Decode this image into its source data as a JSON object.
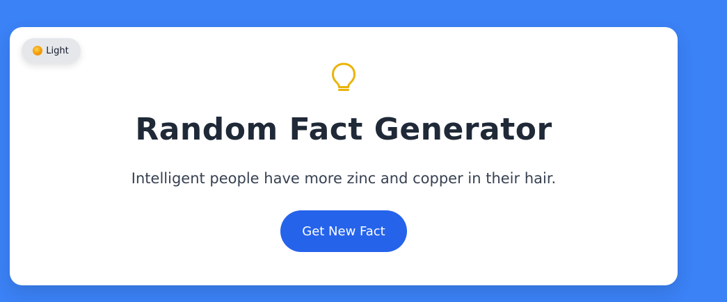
{
  "theme_toggle": {
    "icon": "sun-icon",
    "label": "Light"
  },
  "hero": {
    "icon": "lightbulb-icon",
    "title": "Random Fact Generator",
    "fact": "Intelligent people have more zinc and copper in their hair."
  },
  "actions": {
    "new_fact_label": "Get New Fact"
  },
  "colors": {
    "background": "#3b82f6",
    "card": "#ffffff",
    "accent": "#2563eb",
    "bulb": "#eab308",
    "title": "#1f2937",
    "text": "#374151"
  }
}
